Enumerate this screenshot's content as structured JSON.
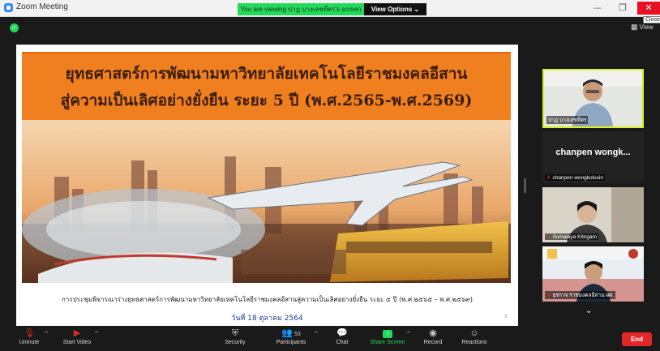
{
  "window": {
    "title": "Zoom Meeting",
    "viewing_banner": "You are viewing ปาฎ บางเลขที่ศร's screen",
    "view_options_label": "View Options ⌄",
    "minimize_glyph": "—",
    "restore_glyph": "❐",
    "close_glyph": "✕",
    "close_tooltip": "Close"
  },
  "top_bar": {
    "view_label": "View"
  },
  "slide": {
    "title_line1": "ยุทธศาสตร์การพัฒนามหาวิทยาลัยเทคโนโลยีราชมงคลอีสาน",
    "title_line2": "สู่ความเป็นเลิศอย่างยั่งยืน ระยะ 5 ปี (พ.ศ.2565-พ.ศ.2569)",
    "caption": "การประชุมพิจารณาร่างยุทธศาสตร์การพัฒนามหาวิทยาลัยเทคโนโลยีราชมงคลอีสานสู่ความเป็นเลิศอย่างยั่งยืน ระยะ ๕ ปี (พ.ศ.๒๕๖๕ – พ.ศ.๒๕๖๙)",
    "date": "วันที่ 18 ตุลาคม 2564",
    "page_number": "1"
  },
  "participants_panel": [
    {
      "name": "ปาฎ บางเลขที่ศร",
      "muted": false,
      "active_speaker": true
    },
    {
      "display": "chanpen wongk...",
      "name": "chanpen wongkolusin",
      "muted": true,
      "video_off": true
    },
    {
      "name": "Sumalaya Kitngam",
      "muted": true
    },
    {
      "name": "ธุรกาจ ราชมงคลอีสาน ผศ.",
      "muted": true
    }
  ],
  "toolbar": {
    "unmute": "Unmute",
    "start_video": "Start Video",
    "security": "Security",
    "participants": "Participants",
    "participants_count": "53",
    "chat": "Chat",
    "share_screen": "Share Screen",
    "record": "Record",
    "reactions": "Reactions",
    "end": "End"
  },
  "colors": {
    "zoom_green": "#23d959",
    "end_red": "#e02828",
    "slide_orange": "#f0801f",
    "active_speaker_border": "#d9f021"
  }
}
